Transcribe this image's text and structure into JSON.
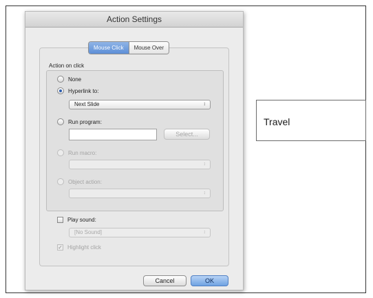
{
  "dialog": {
    "title": "Action Settings",
    "tabs": [
      {
        "label": "Mouse Click",
        "active": true
      },
      {
        "label": "Mouse Over",
        "active": false
      }
    ],
    "group_label": "Action on click",
    "options": {
      "none": {
        "label": "None",
        "checked": false,
        "enabled": true
      },
      "hyperlink": {
        "label": "Hyperlink to:",
        "checked": true,
        "enabled": true,
        "value": "Next Slide"
      },
      "run_program": {
        "label": "Run program:",
        "checked": false,
        "enabled": true,
        "value": "",
        "button": "Select..."
      },
      "run_macro": {
        "label": "Run macro:",
        "checked": false,
        "enabled": false,
        "value": ""
      },
      "object_action": {
        "label": "Object action:",
        "checked": false,
        "enabled": false,
        "value": ""
      }
    },
    "play_sound": {
      "label": "Play sound:",
      "checked": false,
      "value": "[No Sound]"
    },
    "highlight_click": {
      "label": "Highlight click",
      "checked": true,
      "enabled": false
    },
    "buttons": {
      "cancel": "Cancel",
      "ok": "OK"
    }
  },
  "slide_textbox": {
    "text": "Travel"
  },
  "colors": {
    "accent": "#5d8fd7",
    "dialog_bg": "#ececec"
  }
}
